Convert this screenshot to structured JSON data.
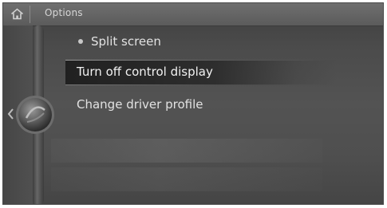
{
  "header": {
    "title": "Options"
  },
  "menu": {
    "items": [
      {
        "label": "Split screen"
      },
      {
        "label": "Turn off control display"
      },
      {
        "label": "Change driver profile"
      }
    ]
  },
  "icons": {
    "home": "home-icon",
    "controller": "controller-knob-icon",
    "back": "chevron-left-icon"
  }
}
